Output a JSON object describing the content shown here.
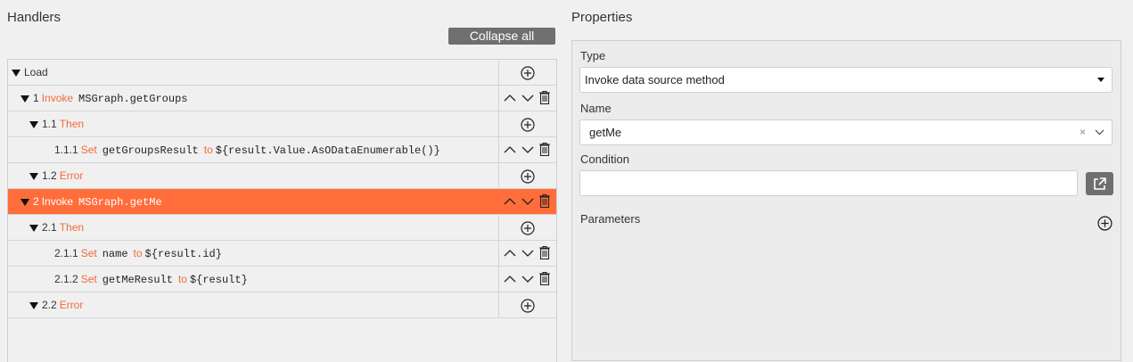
{
  "handlers": {
    "title": "Handlers",
    "collapse_label": "Collapse all",
    "rows": [
      {
        "label": "Load",
        "kw": "",
        "code": "",
        "mid": "",
        "code2": ""
      },
      {
        "num": "1",
        "kw": "Invoke",
        "code": "MSGraph.getGroups",
        "mid": "",
        "code2": ""
      },
      {
        "num": "1.1",
        "kw": "Then",
        "code": "",
        "mid": "",
        "code2": ""
      },
      {
        "num": "1.1.1",
        "kw": "Set",
        "code": "getGroupsResult",
        "mid": "to",
        "code2": "${result.Value.AsODataEnumerable()}"
      },
      {
        "num": "1.2",
        "kw": "Error",
        "code": "",
        "mid": "",
        "code2": ""
      },
      {
        "num": "2",
        "kw": "Invoke",
        "code": "MSGraph.getMe",
        "mid": "",
        "code2": ""
      },
      {
        "num": "2.1",
        "kw": "Then",
        "code": "",
        "mid": "",
        "code2": ""
      },
      {
        "num": "2.1.1",
        "kw": "Set",
        "code": "name",
        "mid": "to",
        "code2": "${result.id}"
      },
      {
        "num": "2.1.2",
        "kw": "Set",
        "code": "getMeResult",
        "mid": "to",
        "code2": "${result}"
      },
      {
        "num": "2.2",
        "kw": "Error",
        "code": "",
        "mid": "",
        "code2": ""
      }
    ]
  },
  "properties": {
    "title": "Properties",
    "type_label": "Type",
    "type_value": "Invoke data source method",
    "name_label": "Name",
    "name_value": "getMe",
    "clear_glyph": "×",
    "condition_label": "Condition",
    "condition_value": "",
    "parameters_label": "Parameters"
  },
  "colors": {
    "accent": "#ff6d3a",
    "keyword": "#f26b3a",
    "button_bg": "#6f6f6f"
  }
}
